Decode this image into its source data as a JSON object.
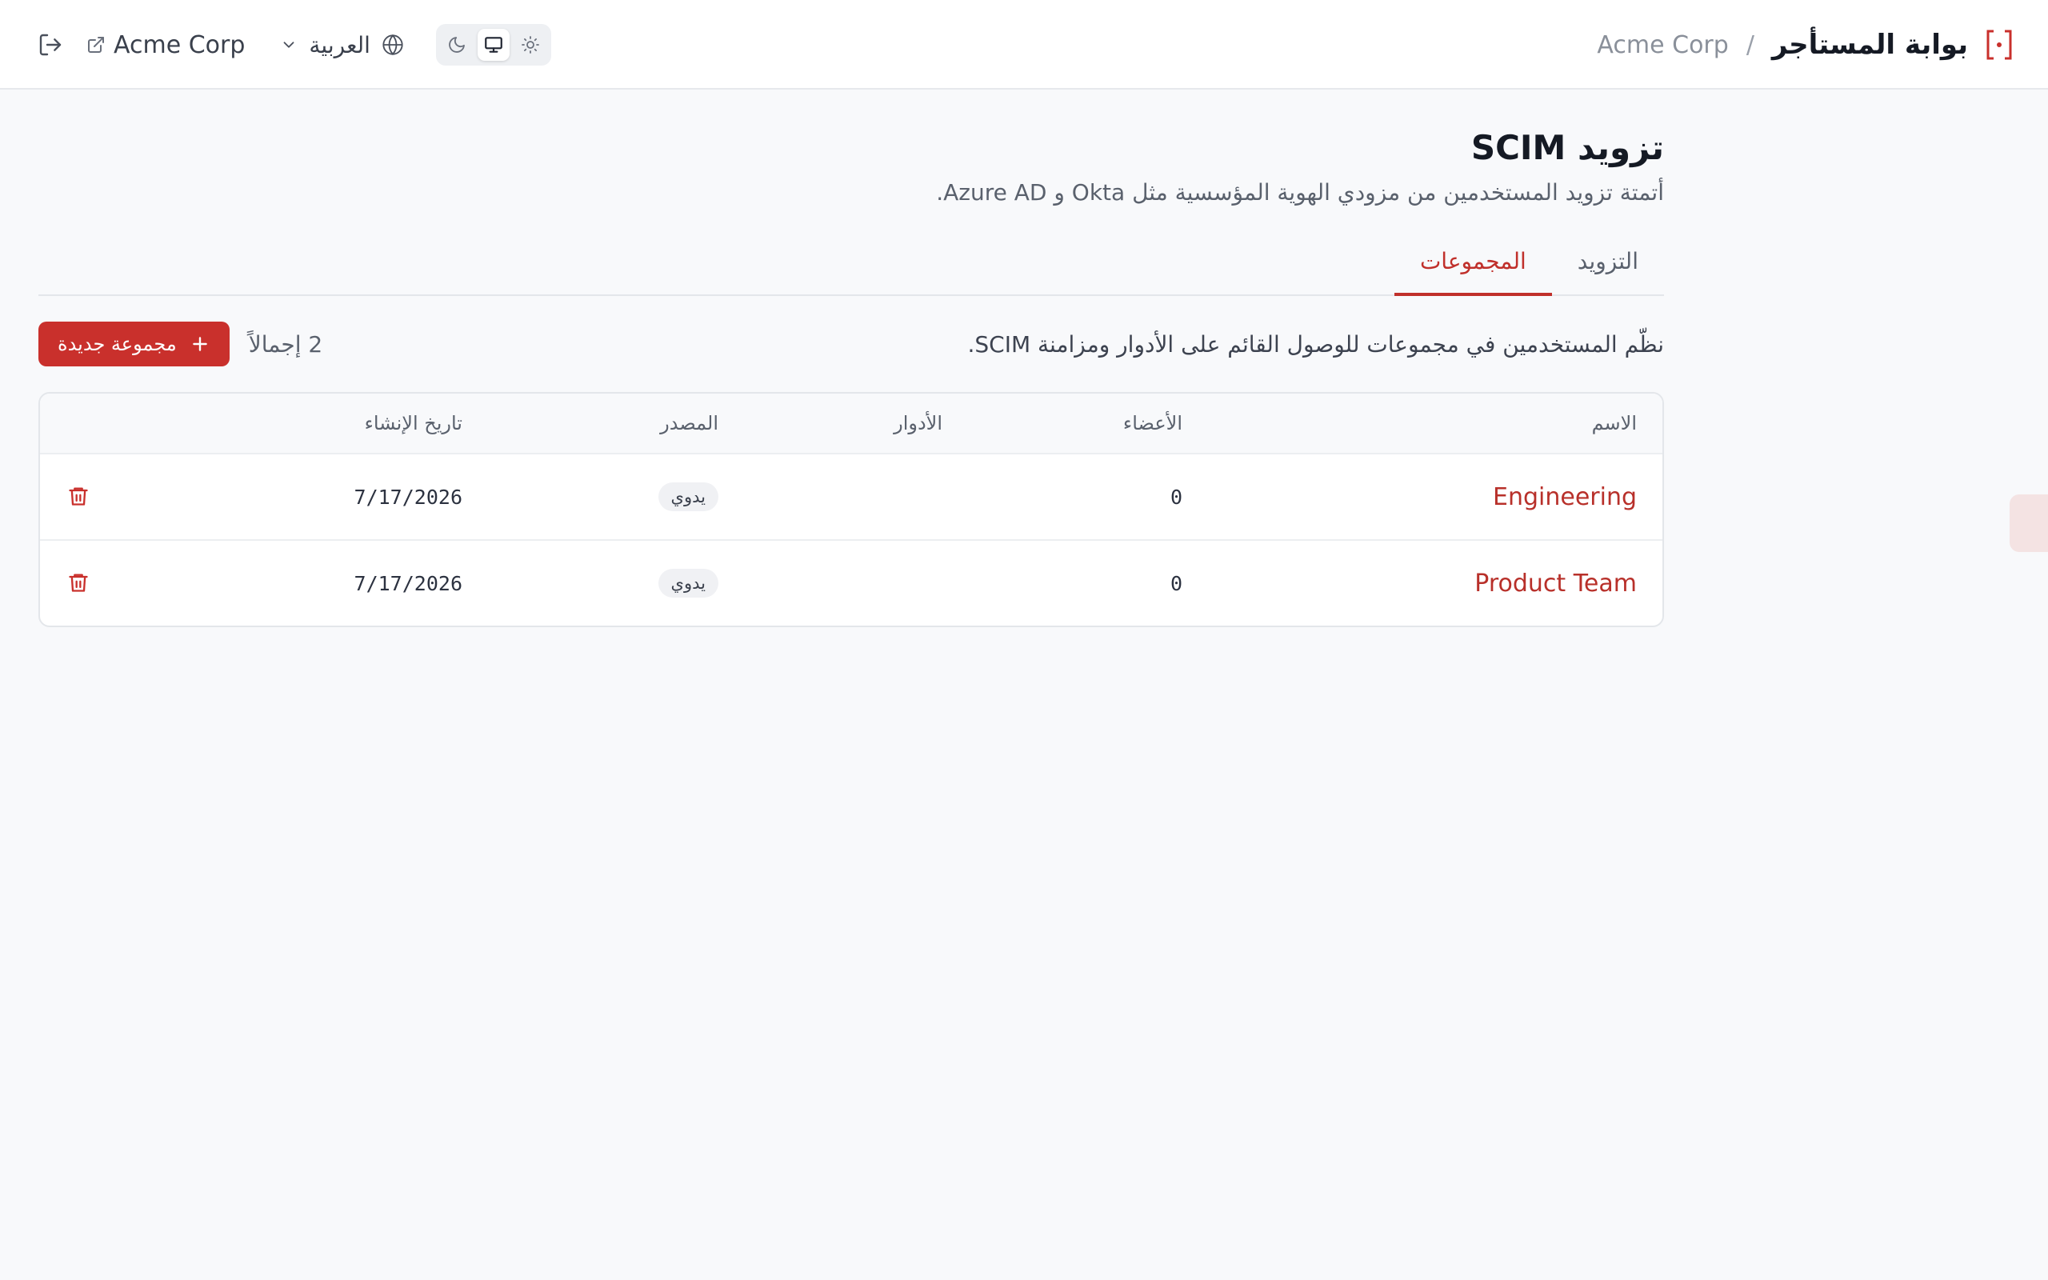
{
  "header": {
    "portal_title": "بوابة المستأجر",
    "separator": "/",
    "tenant_name": "Acme Corp",
    "tenant_link_label": "Acme Corp",
    "language_label": "العربية",
    "theme_modes": [
      "light",
      "system",
      "dark"
    ],
    "active_theme": "system"
  },
  "page": {
    "title": "تزويد SCIM",
    "description": "أتمتة تزويد المستخدمين من مزودي الهوية المؤسسية مثل Okta و Azure AD."
  },
  "tabs": [
    {
      "label": "التزويد",
      "active": false
    },
    {
      "label": "المجموعات",
      "active": true
    }
  ],
  "groups": {
    "description": "نظّم المستخدمين في مجموعات للوصول القائم على الأدوار ومزامنة SCIM.",
    "total_label": "2 إجمالاً",
    "new_button_label": "مجموعة جديدة",
    "columns": {
      "name": "الاسم",
      "members": "الأعضاء",
      "roles": "الأدوار",
      "source": "المصدر",
      "created": "تاريخ الإنشاء"
    },
    "rows": [
      {
        "name": "Engineering",
        "members": "0",
        "roles": "",
        "source": "يدوي",
        "created": "7/17/2026"
      },
      {
        "name": "Product Team",
        "members": "0",
        "roles": "",
        "source": "يدوي",
        "created": "7/17/2026"
      }
    ]
  },
  "colors": {
    "accent": "#c9302c",
    "link": "#b8302a",
    "background": "#f8f9fb"
  },
  "icons": {
    "logo": "bracket-dot-logo-icon",
    "logout": "logout-icon",
    "external": "external-link-icon",
    "chevron": "chevron-down-icon",
    "globe": "globe-icon",
    "moon": "moon-icon",
    "monitor": "monitor-icon",
    "sun": "sun-icon",
    "plus": "plus-icon",
    "trash": "trash-icon"
  }
}
